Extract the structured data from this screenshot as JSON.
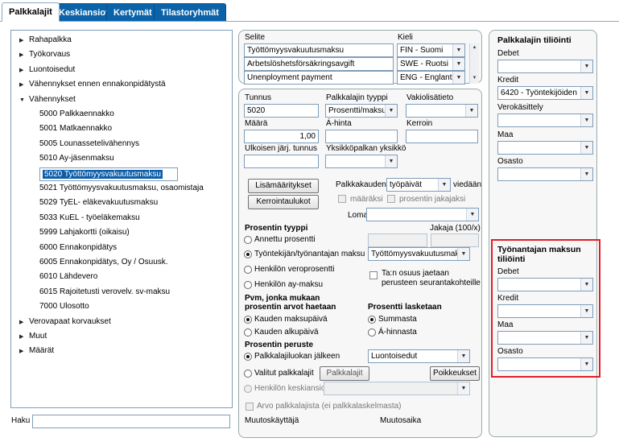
{
  "tabs": [
    "Palkkalajit",
    "Keskiansiot",
    "Kertymät",
    "Tilastoryhmät"
  ],
  "tree": {
    "items": [
      {
        "label": "Rahapalkka",
        "arrow": "▶",
        "indent": 0
      },
      {
        "label": "Työkorvaus",
        "arrow": "▶",
        "indent": 0
      },
      {
        "label": "Luontoisedut",
        "arrow": "▶",
        "indent": 0
      },
      {
        "label": "Vähennykset ennen ennakonpidätystä",
        "arrow": "▶",
        "indent": 0
      },
      {
        "label": "Vähennykset",
        "arrow": "▼",
        "indent": 0
      },
      {
        "label": "5000 Palkkaennakko",
        "arrow": "",
        "indent": 1
      },
      {
        "label": "5001 Matkaennakko",
        "arrow": "",
        "indent": 1
      },
      {
        "label": "5005 Lounassetelivähennys",
        "arrow": "",
        "indent": 1
      },
      {
        "label": "5010 Ay-jäsenmaksu",
        "arrow": "",
        "indent": 1
      },
      {
        "label": "5020 Työttömyysvakuutusmaksu",
        "arrow": "",
        "indent": 1,
        "selected": true
      },
      {
        "label": "5021 Työttömyysvakuutusmaksu, osaomistaja",
        "arrow": "",
        "indent": 1
      },
      {
        "label": "5029 TyEL- eläkevakuutusmaksu",
        "arrow": "",
        "indent": 1
      },
      {
        "label": "5033 KuEL - työeläkemaksu",
        "arrow": "",
        "indent": 1
      },
      {
        "label": "5999 Lahjakortti (oikaisu)",
        "arrow": "",
        "indent": 1
      },
      {
        "label": "6000 Ennakonpidätys",
        "arrow": "",
        "indent": 1
      },
      {
        "label": "6005 Ennakonpidätys, Oy / Osuusk.",
        "arrow": "",
        "indent": 1
      },
      {
        "label": "6010 Lähdevero",
        "arrow": "",
        "indent": 1
      },
      {
        "label": "6015 Rajoitetusti verovelv. sv-maksu",
        "arrow": "",
        "indent": 1
      },
      {
        "label": "7000 Ulosotto",
        "arrow": "",
        "indent": 1
      },
      {
        "label": "Verovapaat korvaukset",
        "arrow": "▶",
        "indent": 0
      },
      {
        "label": "Muut",
        "arrow": "▶",
        "indent": 0
      },
      {
        "label": "Määrät",
        "arrow": "▶",
        "indent": 0
      }
    ]
  },
  "search": {
    "label": "Haku",
    "value": ""
  },
  "names": {
    "selite_label": "Selite",
    "kieli_label": "Kieli",
    "rows": [
      {
        "selite": "Työttömyysvakuutusmaksu",
        "kieli": "FIN - Suomi"
      },
      {
        "selite": "Arbetslöshetsförsäkringsavgift",
        "kieli": "SWE - Ruotsi"
      },
      {
        "selite": "Unenployment payment",
        "kieli": "ENG - Englanti"
      }
    ]
  },
  "form": {
    "tunnus_label": "Tunnus",
    "tunnus_value": "5020",
    "tyyppi_label": "Palkkalajin tyyppi",
    "tyyppi_value": "Prosentti/maksu",
    "vakio_label": "Vakiolisätieto",
    "vakio_value": "",
    "maara_label": "Määrä",
    "maara_value": "1,00",
    "ahinta_label": "Á-hinta",
    "ahinta_value": "",
    "kerroin_label": "Kerroin",
    "kerroin_value": "",
    "ulkoinen_label": "Ulkoisen järj. tunnus",
    "ulkoinen_value": "",
    "yksikko_label": "Yksikköpalkan yksikkö",
    "yksikko_value": "",
    "lisamaaritykset_label": "Lisämääritykset",
    "kerrointaulukot_label": "Kerrointaulukot",
    "palkkakauden_label": "Palkkakauden",
    "palkkakauden_value": "työpäivät",
    "viedaan_label": "viedään",
    "maaraksi_label": "määräksi",
    "jakajaksi_label": "prosentin jakajaksi",
    "loma_label": "Loma",
    "loma_value": "",
    "prosentin_tyyppi_label": "Prosentin tyyppi",
    "jakaja_label": "Jakaja (100/x)",
    "annettu_label": "Annettu prosentti",
    "tyontekija_label": "Työntekijän/työnantajan maksu",
    "tyontekija_value": "Työttömyysvakuutusmaksu",
    "veroprosentti_label": "Henkilön veroprosentti",
    "ay_label": "Henkilön ay-maksu",
    "taosuus_label_1": "Ta:n osuus jaetaan",
    "taosuus_label_2": "perusteen seurantakohteille",
    "pvm_label_1": "Pvm, jonka mukaan",
    "pvm_label_2": "prosentin arvot haetaan",
    "maksupaiva_label": "Kauden maksupäivä",
    "alkupaiva_label": "Kauden alkupäivä",
    "lasketaan_label": "Prosentti lasketaan",
    "summasta_label": "Summasta",
    "ahinnasta_label": "Á-hinnasta",
    "peruste_label": "Prosentin peruste",
    "luokan_label": "Palkkalajiluokan jälkeen",
    "luokan_value": "Luontoisedut",
    "valitut_label": "Valitut palkkalajit",
    "palkkalajit_btn": "Palkkalajit",
    "poikkeukset_btn": "Poikkeukset",
    "keskiansio_label": "Henkilön keskiansio",
    "keskiansio_value": "",
    "arvo_label": "Arvo palkkalajista (ei palkkalaskelmasta)",
    "muutoskayttaja_label": "Muutoskäyttäjä",
    "muutosaika_label": "Muutosaika"
  },
  "accounts": {
    "title": "Palkkalajin tiliöinti",
    "debet_label": "Debet",
    "debet_value": "",
    "kredit_label": "Kredit",
    "kredit_value": "6420 - Työntekijöiden",
    "verokasittely_label": "Verokäsittely",
    "verokasittely_value": "",
    "maa_label": "Maa",
    "maa_value": "",
    "osasto_label": "Osasto",
    "osasto_value": ""
  },
  "employer": {
    "title_1": "Työnantajan maksun",
    "title_2": "tiliöinti",
    "debet_label": "Debet",
    "debet_value": "",
    "kredit_label": "Kredit",
    "kredit_value": "",
    "maa_label": "Maa",
    "maa_value": "",
    "osasto_label": "Osasto",
    "osasto_value": ""
  },
  "colors": {
    "tab_active": "#0a63a9",
    "selection": "#0d5ea8",
    "highlight": "#e21d25"
  }
}
